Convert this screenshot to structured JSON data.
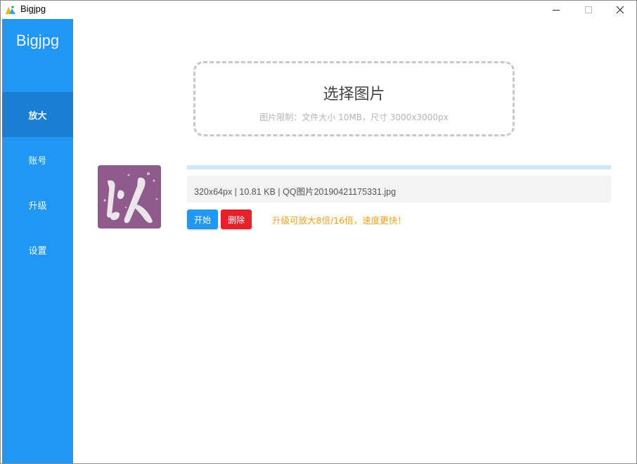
{
  "window": {
    "title": "Bigjpg",
    "controls": {
      "minimize": "minimize-icon",
      "maximize": "maximize-icon",
      "close": "close-icon"
    }
  },
  "sidebar": {
    "brand": "Bigjpg",
    "items": [
      {
        "label": "放大",
        "active": true
      },
      {
        "label": "账号",
        "active": false
      },
      {
        "label": "升级",
        "active": false
      },
      {
        "label": "设置",
        "active": false
      }
    ]
  },
  "dropzone": {
    "title": "选择图片",
    "subtitle": "图片限制：文件大小 10MB，尺寸 3000x3000px"
  },
  "file": {
    "info": "320x64px | 10.81 KB | QQ图片20190421175331.jpg",
    "progress": 0,
    "thumbnail_glyph": "以"
  },
  "actions": {
    "start_label": "开始",
    "delete_label": "删除",
    "upgrade_hint": "升级可放大8倍/16倍，速度更快！"
  },
  "colors": {
    "accent": "#2196f3",
    "sidebar_active": "#1a7fd4",
    "danger": "#e5222b",
    "hint": "#f0a020",
    "thumbnail_bg": "#8f5a8c"
  }
}
